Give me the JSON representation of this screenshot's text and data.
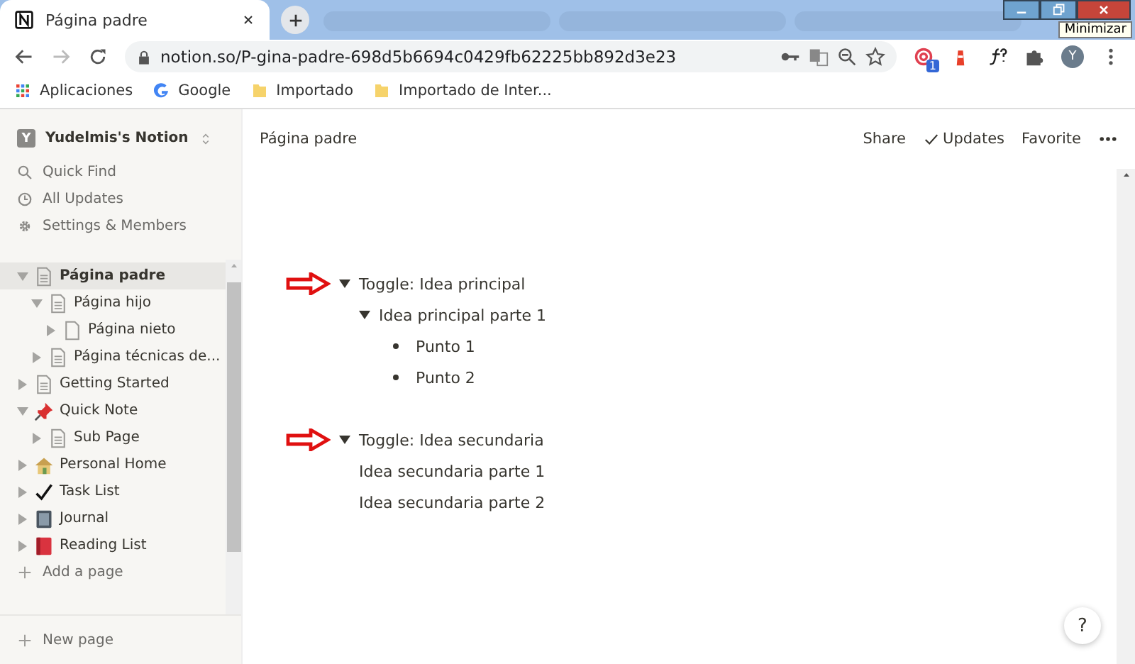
{
  "browser": {
    "tab": {
      "title": "Página padre"
    },
    "url": "notion.so/P-gina-padre-698d5b6694c0429fb62225bb892d3e23",
    "extension_badge": "1",
    "profile_initial": "Y",
    "tooltip": "Minimizar",
    "bookmarks": [
      {
        "label": "Aplicaciones",
        "kind": "apps"
      },
      {
        "label": "Google",
        "kind": "google"
      },
      {
        "label": "Importado",
        "kind": "folder"
      },
      {
        "label": "Importado de Inter...",
        "kind": "folder"
      }
    ]
  },
  "sidebar": {
    "workspace": {
      "initial": "Y",
      "name": "Yudelmis's Notion"
    },
    "actions": [
      {
        "label": "Quick Find",
        "kind": "search"
      },
      {
        "label": "All Updates",
        "kind": "clock"
      },
      {
        "label": "Settings & Members",
        "kind": "gear"
      }
    ],
    "pages": [
      {
        "label": "Página padre",
        "kind": "page",
        "expanded": true,
        "selected": true,
        "children": [
          {
            "label": "Página hijo",
            "kind": "page",
            "expanded": true,
            "selected": false,
            "children": [
              {
                "label": "Página nieto",
                "kind": "blank",
                "expanded": false,
                "selected": false
              }
            ]
          },
          {
            "label": "Página técnicas de...",
            "kind": "page",
            "expanded": false,
            "selected": false
          }
        ]
      },
      {
        "label": "Getting Started",
        "kind": "page",
        "expanded": false,
        "selected": false
      },
      {
        "label": "Quick Note",
        "kind": "pin",
        "expanded": true,
        "selected": false,
        "children": [
          {
            "label": "Sub Page",
            "kind": "page",
            "expanded": false,
            "selected": false
          }
        ]
      },
      {
        "label": "Personal Home",
        "kind": "house",
        "expanded": false,
        "selected": false
      },
      {
        "label": "Task List",
        "kind": "check",
        "expanded": false,
        "selected": false
      },
      {
        "label": "Journal",
        "kind": "notebook",
        "expanded": false,
        "selected": false
      },
      {
        "label": "Reading List",
        "kind": "book",
        "expanded": false,
        "selected": false
      }
    ],
    "add_page": "Add a page",
    "new_page": "New page"
  },
  "topbar": {
    "breadcrumb": "Página padre",
    "actions": [
      "Share",
      "Updates",
      "Favorite"
    ]
  },
  "blocks": [
    {
      "kind": "toggle",
      "text": "Toggle: Idea principal",
      "expanded": true,
      "annotated": true,
      "children": [
        {
          "kind": "toggle",
          "text": "Idea principal parte 1",
          "expanded": true,
          "children": [
            {
              "kind": "bullet",
              "text": "Punto 1"
            },
            {
              "kind": "bullet",
              "text": "Punto 2"
            }
          ]
        }
      ]
    },
    {
      "kind": "toggle",
      "text": "Toggle: Idea secundaria",
      "expanded": true,
      "annotated": true,
      "children": [
        {
          "kind": "text",
          "text": "Idea secundaria parte 1"
        },
        {
          "kind": "text",
          "text": "Idea secundaria parte 2"
        }
      ]
    }
  ],
  "help": "?"
}
